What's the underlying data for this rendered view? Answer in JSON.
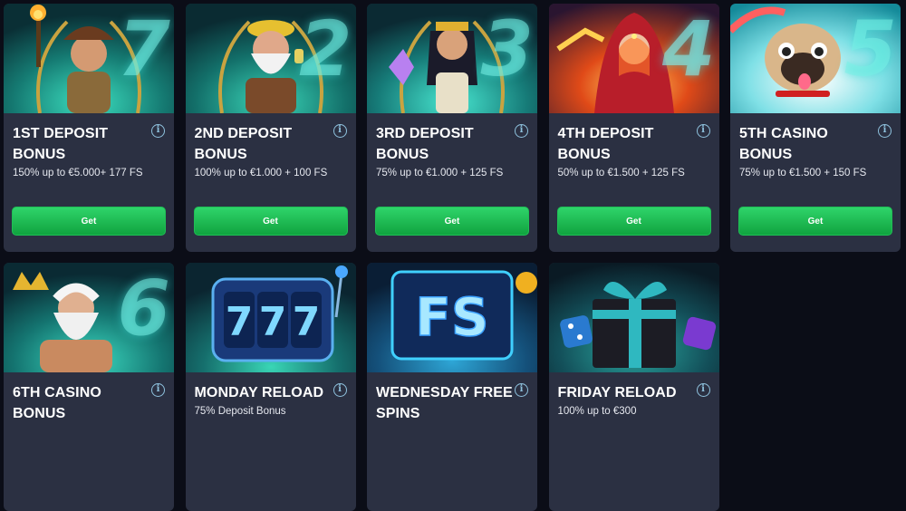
{
  "info_glyph": "i",
  "cards": [
    {
      "title": "1ST DEPOSIT BONUS",
      "subtitle": "150% up to €5.000+ 177 FS",
      "button": "Get",
      "number": "7",
      "art": "explorer-woman-with-torch",
      "accent": "#1fb49a"
    },
    {
      "title": "2ND DEPOSIT BONUS",
      "subtitle": "100% up to €1.000 + 100 FS",
      "button": "Get",
      "number": "2",
      "art": "old-miner-with-lantern",
      "accent": "#1aa690"
    },
    {
      "title": "3RD DEPOSIT BONUS",
      "subtitle": "75% up to €1.000 + 125 FS",
      "button": "Get",
      "number": "3",
      "art": "cleopatra-queen",
      "accent": "#22b7a6"
    },
    {
      "title": "4TH DEPOSIT BONUS",
      "subtitle": "50% up to €1.500 + 125 FS",
      "button": "Get",
      "number": "4",
      "art": "fire-sorceress",
      "accent": "#d74b1f"
    },
    {
      "title": "5TH CASINO BONUS",
      "subtitle": "75% up to €1.500 + 150 FS",
      "button": "Get",
      "number": "5",
      "art": "pug-dog",
      "accent": "#27c3bd"
    },
    {
      "title": "6TH CASINO BONUS",
      "subtitle": "",
      "button": "",
      "number": "6",
      "art": "zeus-god",
      "accent": "#1fb29a"
    },
    {
      "title": "MONDAY RELOAD",
      "subtitle": "75% Deposit Bonus",
      "button": "",
      "number": "",
      "art": "slot-777",
      "accent": "#1aa690"
    },
    {
      "title": "WEDNESDAY FREE SPINS",
      "subtitle": "",
      "button": "",
      "number": "",
      "art": "fs-neon-sign",
      "accent": "#23a3d6"
    },
    {
      "title": "FRIDAY RELOAD",
      "subtitle": "100% up to €300",
      "button": "",
      "number": "",
      "art": "gift-box-dice",
      "accent": "#1b8f8a"
    }
  ]
}
